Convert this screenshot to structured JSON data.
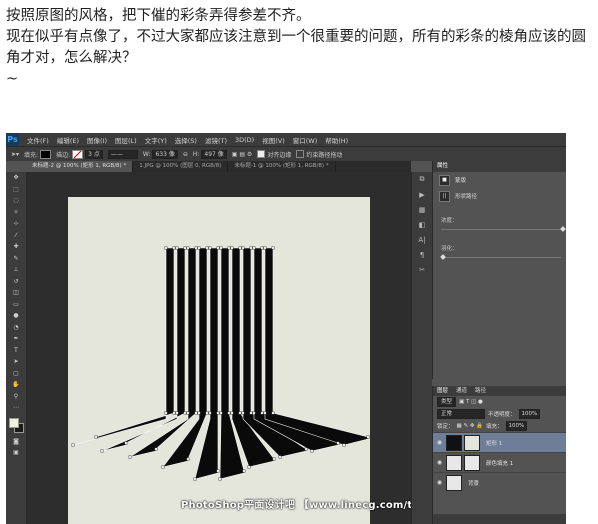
{
  "post": {
    "line1": "按照原图的风格，把下催的彩条弄得参差不齐。",
    "line2": "现在似乎有点像了，不过大家都应该注意到一个很重要的问题，所有的彩条的棱角应该的圆角才对，怎么解决？",
    "line3": "~"
  },
  "ps": {
    "logo": "Ps",
    "menu": [
      "文件(F)",
      "编辑(E)",
      "图像(I)",
      "图层(L)",
      "文字(Y)",
      "选择(S)",
      "滤镜(T)",
      "3D(D)",
      "视图(V)",
      "窗口(W)",
      "帮助(H)"
    ],
    "options": {
      "fill_label": "填充:",
      "stroke_label": "描边:",
      "stroke_size": "3 点",
      "w_label": "W:",
      "w_value": "633 像",
      "h_label": "H:",
      "h_value": "497 像",
      "align_edges": "对齐边缘",
      "constrain_path": "约束路径拖动",
      "fill_color": "#000000",
      "stroke_color": "#ffffff"
    },
    "tabs": [
      "未标题-2 @ 100% (矩形 1, RGB/8) *",
      "1.JPG @ 100% (图层 0, RGB/8)",
      "未标题-1 @ 100% (矩形 1, RGB/8) *"
    ],
    "properties": {
      "tabs": [
        "属性"
      ],
      "row1": "蒙版",
      "row2": "形状路径",
      "density_label": "浓度：",
      "feather_label": "羽化："
    },
    "layers_panel": {
      "tabs": [
        "图层",
        "通道",
        "路径"
      ],
      "kind": "类型",
      "blend_mode": "正常",
      "opacity_label": "不透明度：",
      "opacity_value": "100%",
      "lock_label": "锁定：",
      "fill_label": "填充：",
      "fill_value": "100%",
      "layers": [
        {
          "name": "矩形 1",
          "active": true
        },
        {
          "name": "颜色填充 1",
          "active": false
        },
        {
          "name": "背景",
          "active": false
        }
      ]
    },
    "watermark": "PhotoShop平面设计吧 【www.linecg.com/tieba/1783】"
  }
}
